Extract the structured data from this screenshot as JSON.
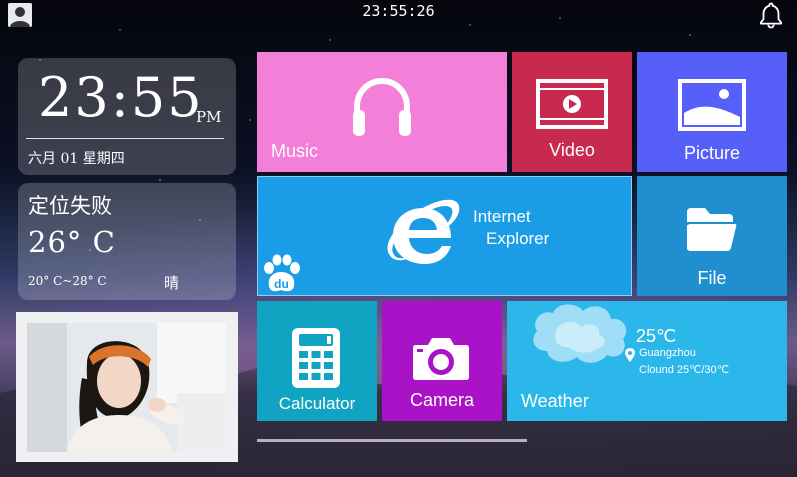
{
  "topbar": {
    "time": "23:55:26"
  },
  "clock": {
    "time": "23:55",
    "ampm": "PM",
    "date": "六月 01 星期四"
  },
  "weather_widget": {
    "status": "定位失败",
    "temp": "26° C",
    "range": "20° C~28° C",
    "condition": "晴"
  },
  "tiles": {
    "music": {
      "label": "Music",
      "color": "#f37fd9",
      "icon": "headphones-icon"
    },
    "video": {
      "label": "Video",
      "color": "#c8294f",
      "icon": "video-play-icon"
    },
    "picture": {
      "label": "Picture",
      "color": "#5660f8",
      "icon": "picture-icon"
    },
    "ie": {
      "label_line1": "Internet",
      "label_line2": "Explorer",
      "color": "#1a9ce7",
      "icon": "internet-explorer-icon",
      "badge_text": "du"
    },
    "file": {
      "label": "File",
      "color": "#1f8fd0",
      "icon": "folder-icon"
    },
    "calculator": {
      "label": "Calculator",
      "color": "#11a3c2",
      "icon": "calculator-icon"
    },
    "camera": {
      "label": "Camera",
      "color": "#a912c7",
      "icon": "camera-icon"
    },
    "weather": {
      "label": "Weather",
      "color": "#2bb7ea",
      "temp": "25℃",
      "city": "Guangzhou",
      "detail": "Clound 25℃/30℃",
      "icon": "cloud-icon"
    }
  }
}
